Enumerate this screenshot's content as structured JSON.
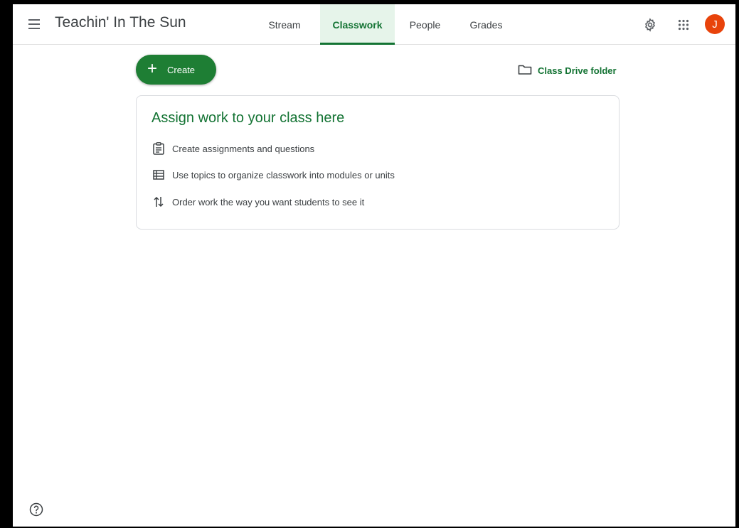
{
  "header": {
    "class_name": "Teachin' In The Sun",
    "tabs": [
      {
        "label": "Stream",
        "active": false
      },
      {
        "label": "Classwork",
        "active": true
      },
      {
        "label": "People",
        "active": false
      },
      {
        "label": "Grades",
        "active": false
      }
    ],
    "avatar_initial": "J",
    "icons": {
      "menu": "hamburger-menu-icon",
      "settings": "gear-icon",
      "apps": "apps-grid-icon"
    }
  },
  "toolbar": {
    "create_label": "Create",
    "create_icon": "+",
    "drive_folder_label": "Class Drive folder"
  },
  "empty_state": {
    "title": "Assign work to your class here",
    "items": [
      {
        "icon": "assignment-icon",
        "text": "Create assignments and questions"
      },
      {
        "icon": "topic-list-icon",
        "text": "Use topics to organize classwork into modules or units"
      },
      {
        "icon": "reorder-arrows-icon",
        "text": "Order work the way you want students to see it"
      }
    ]
  },
  "colors": {
    "accent": "#137333",
    "create_button": "#1e7e34",
    "active_tab_bg": "#e6f4ea",
    "avatar": "#e8430b"
  }
}
